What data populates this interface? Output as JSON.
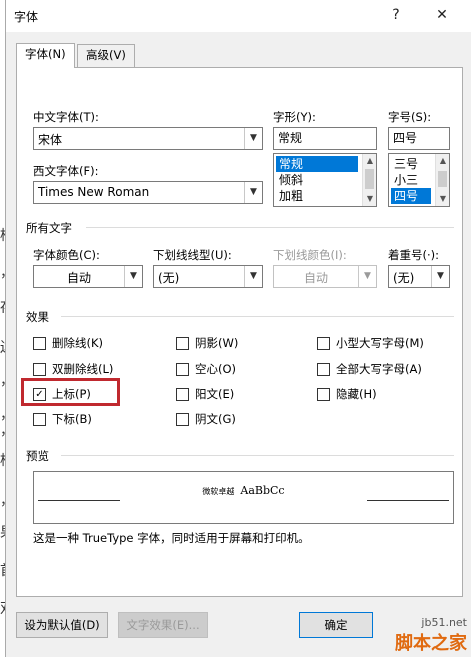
{
  "dialog": {
    "title": "字体",
    "help_glyph": "?",
    "close_glyph": "✕"
  },
  "tabs": [
    {
      "label": "字体(N)",
      "active": true
    },
    {
      "label": "高级(V)",
      "active": false
    }
  ],
  "fonts": {
    "chinese_label": "中文字体(T):",
    "chinese_value": "宋体",
    "western_label": "西文字体(F):",
    "western_value": "Times New Roman",
    "style_label": "字形(Y):",
    "style_value": "常规",
    "style_options": [
      "常规",
      "倾斜",
      "加粗"
    ],
    "size_label": "字号(S):",
    "size_value": "四号",
    "size_options": [
      "三号",
      "小三",
      "四号"
    ]
  },
  "all_text": {
    "section_label": "所有文字",
    "font_color_label": "字体颜色(C):",
    "font_color_value": "自动",
    "underline_type_label": "下划线线型(U):",
    "underline_type_value": "(无)",
    "underline_color_label": "下划线颜色(I):",
    "underline_color_value": "自动",
    "emphasis_label": "着重号(·):",
    "emphasis_value": "(无)"
  },
  "effects": {
    "section_label": "效果",
    "items": [
      {
        "label": "删除线(K)",
        "checked": false
      },
      {
        "label": "双删除线(L)",
        "checked": false
      },
      {
        "label": "上标(P)",
        "checked": true
      },
      {
        "label": "下标(B)",
        "checked": false
      },
      {
        "label": "阴影(W)",
        "checked": false
      },
      {
        "label": "空心(O)",
        "checked": false
      },
      {
        "label": "阳文(E)",
        "checked": false
      },
      {
        "label": "阴文(G)",
        "checked": false
      },
      {
        "label": "小型大写字母(M)",
        "checked": false
      },
      {
        "label": "全部大写字母(A)",
        "checked": false
      },
      {
        "label": "隐藏(H)",
        "checked": false
      }
    ],
    "check_glyph": "✓"
  },
  "preview": {
    "section_label": "预览",
    "sample_cn": "微软卓越",
    "sample_en": "AaBbCc",
    "note": "这是一种 TrueType 字体，同时适用于屏幕和打印机。"
  },
  "buttons": {
    "set_default": "设为默认值(D)",
    "text_effects": "文字效果(E)...",
    "ok": "确定"
  },
  "icons": {
    "dropdown_arrow": "▼",
    "scroll_up": "▲",
    "scroll_down": "▼"
  },
  "background_doc_chars": [
    "栝",
    "，",
    "存",
    "边",
    "，",
    "，",
    "，",
    "栝",
    "，",
    "果",
    "首",
    "双"
  ],
  "watermark": {
    "site": "jb51.net",
    "name": "脚本之家"
  }
}
